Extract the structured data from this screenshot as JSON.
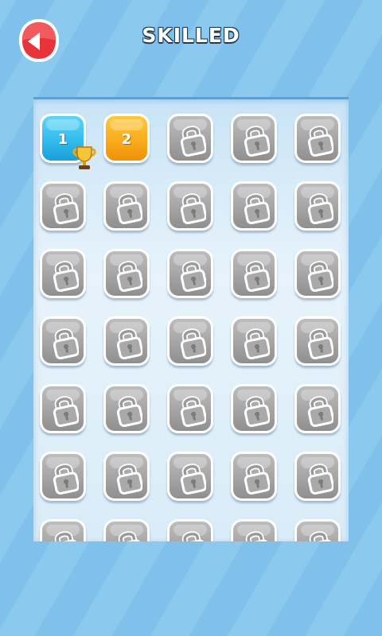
{
  "header": {
    "title": "SKILLED",
    "back_icon": "back-arrow-icon"
  },
  "colors": {
    "unlocked_1": "#2fb8ec",
    "unlocked_2": "#f8a91a",
    "locked": "#a4a4a4",
    "back_button": "#e8333b"
  },
  "grid": {
    "columns": 5,
    "visible_rows": 7,
    "levels": [
      {
        "label": "1",
        "state": "completed",
        "color": "blue",
        "icon": "trophy-icon"
      },
      {
        "label": "2",
        "state": "unlocked",
        "color": "orange"
      }
    ],
    "locked_icon": "lock-icon"
  }
}
